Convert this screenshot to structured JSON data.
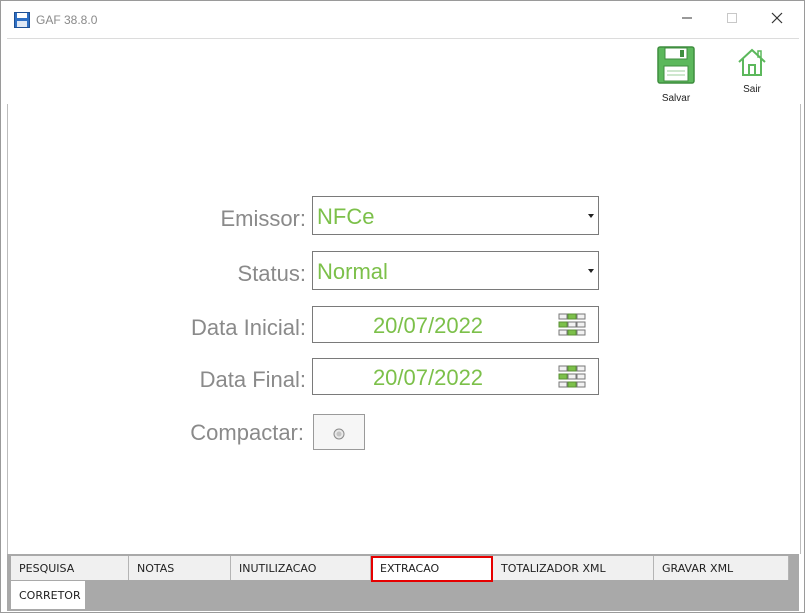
{
  "window": {
    "title": "GAF 38.8.0",
    "icons": {
      "app": "floppy-disk-icon",
      "minimize": "minimize-icon",
      "maximize": "maximize-icon",
      "close": "close-icon"
    }
  },
  "toolbar": {
    "save_label": "Salvar",
    "exit_label": "Sair"
  },
  "form": {
    "emissor": {
      "label": "Emissor:",
      "value": "NFCe"
    },
    "status": {
      "label": "Status:",
      "value": "Normal"
    },
    "data_inicial": {
      "label": "Data Inicial:",
      "value": "20/07/2022"
    },
    "data_final": {
      "label": "Data Final:",
      "value": "20/07/2022"
    },
    "compactar": {
      "label": "Compactar:"
    }
  },
  "tabs": {
    "row1": [
      "PESQUISA",
      "NOTAS",
      "INUTILIZACAO",
      "EXTRACAO",
      "TOTALIZADOR XML",
      "GRAVAR XML"
    ],
    "row2": [
      "CORRETOR"
    ],
    "active": "EXTRACAO"
  },
  "colors": {
    "value_green": "#7cc04a",
    "label_gray": "#8a8a8a",
    "active_tab_border": "#e60000"
  }
}
